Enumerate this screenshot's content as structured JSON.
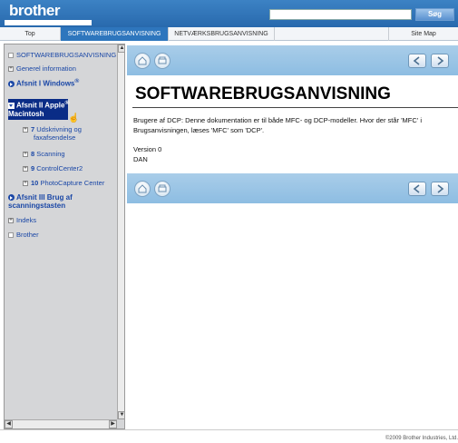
{
  "header": {
    "logo": "brother",
    "search_placeholder": "",
    "search_button": "Søg"
  },
  "tabs": [
    {
      "label": "Top"
    },
    {
      "label": "SOFTWAREBRUGSANVISNING"
    },
    {
      "label": "NETVÆRKSBRUGSANVISNING"
    },
    {
      "label": "Site Map"
    }
  ],
  "sidebar": {
    "items": [
      {
        "label": "SOFTWAREBRUGSANVISNING"
      },
      {
        "label": "Generel information"
      },
      {
        "label": "Afsnit I Windows",
        "sup": "®"
      },
      {
        "label_line1": "Afsnit II Apple",
        "sup": "®",
        "label_line2": "Macintosh"
      },
      {
        "num": "7",
        "label_line1": "Udskrivning og",
        "label_line2": "faxafsendelse"
      },
      {
        "num": "8",
        "label": "Scanning"
      },
      {
        "num": "9",
        "label": "ControlCenter2"
      },
      {
        "num": "10",
        "label": "PhotoCapture Center"
      },
      {
        "label_line1": "Afsnit III Brug af",
        "label_line2": "scanningstasten"
      },
      {
        "label": "Indeks"
      },
      {
        "label": "Brother"
      }
    ]
  },
  "content": {
    "title": "SOFTWAREBRUGSANVISNING",
    "description": "Brugere af DCP: Denne dokumentation er til både MFC- og DCP-modeller. Hvor der står 'MFC' i Brugsanvisningen, læses 'MFC' som 'DCP'.",
    "version": "Version 0",
    "language": "DAN"
  },
  "footer": {
    "copyright": "©2009 Brother Industries, Ltd."
  },
  "colors": {
    "header_blue": "#2869ad",
    "nav_blue": "#9cc6e6",
    "link_blue": "#1a47a6",
    "selection": "#0a2c86"
  }
}
